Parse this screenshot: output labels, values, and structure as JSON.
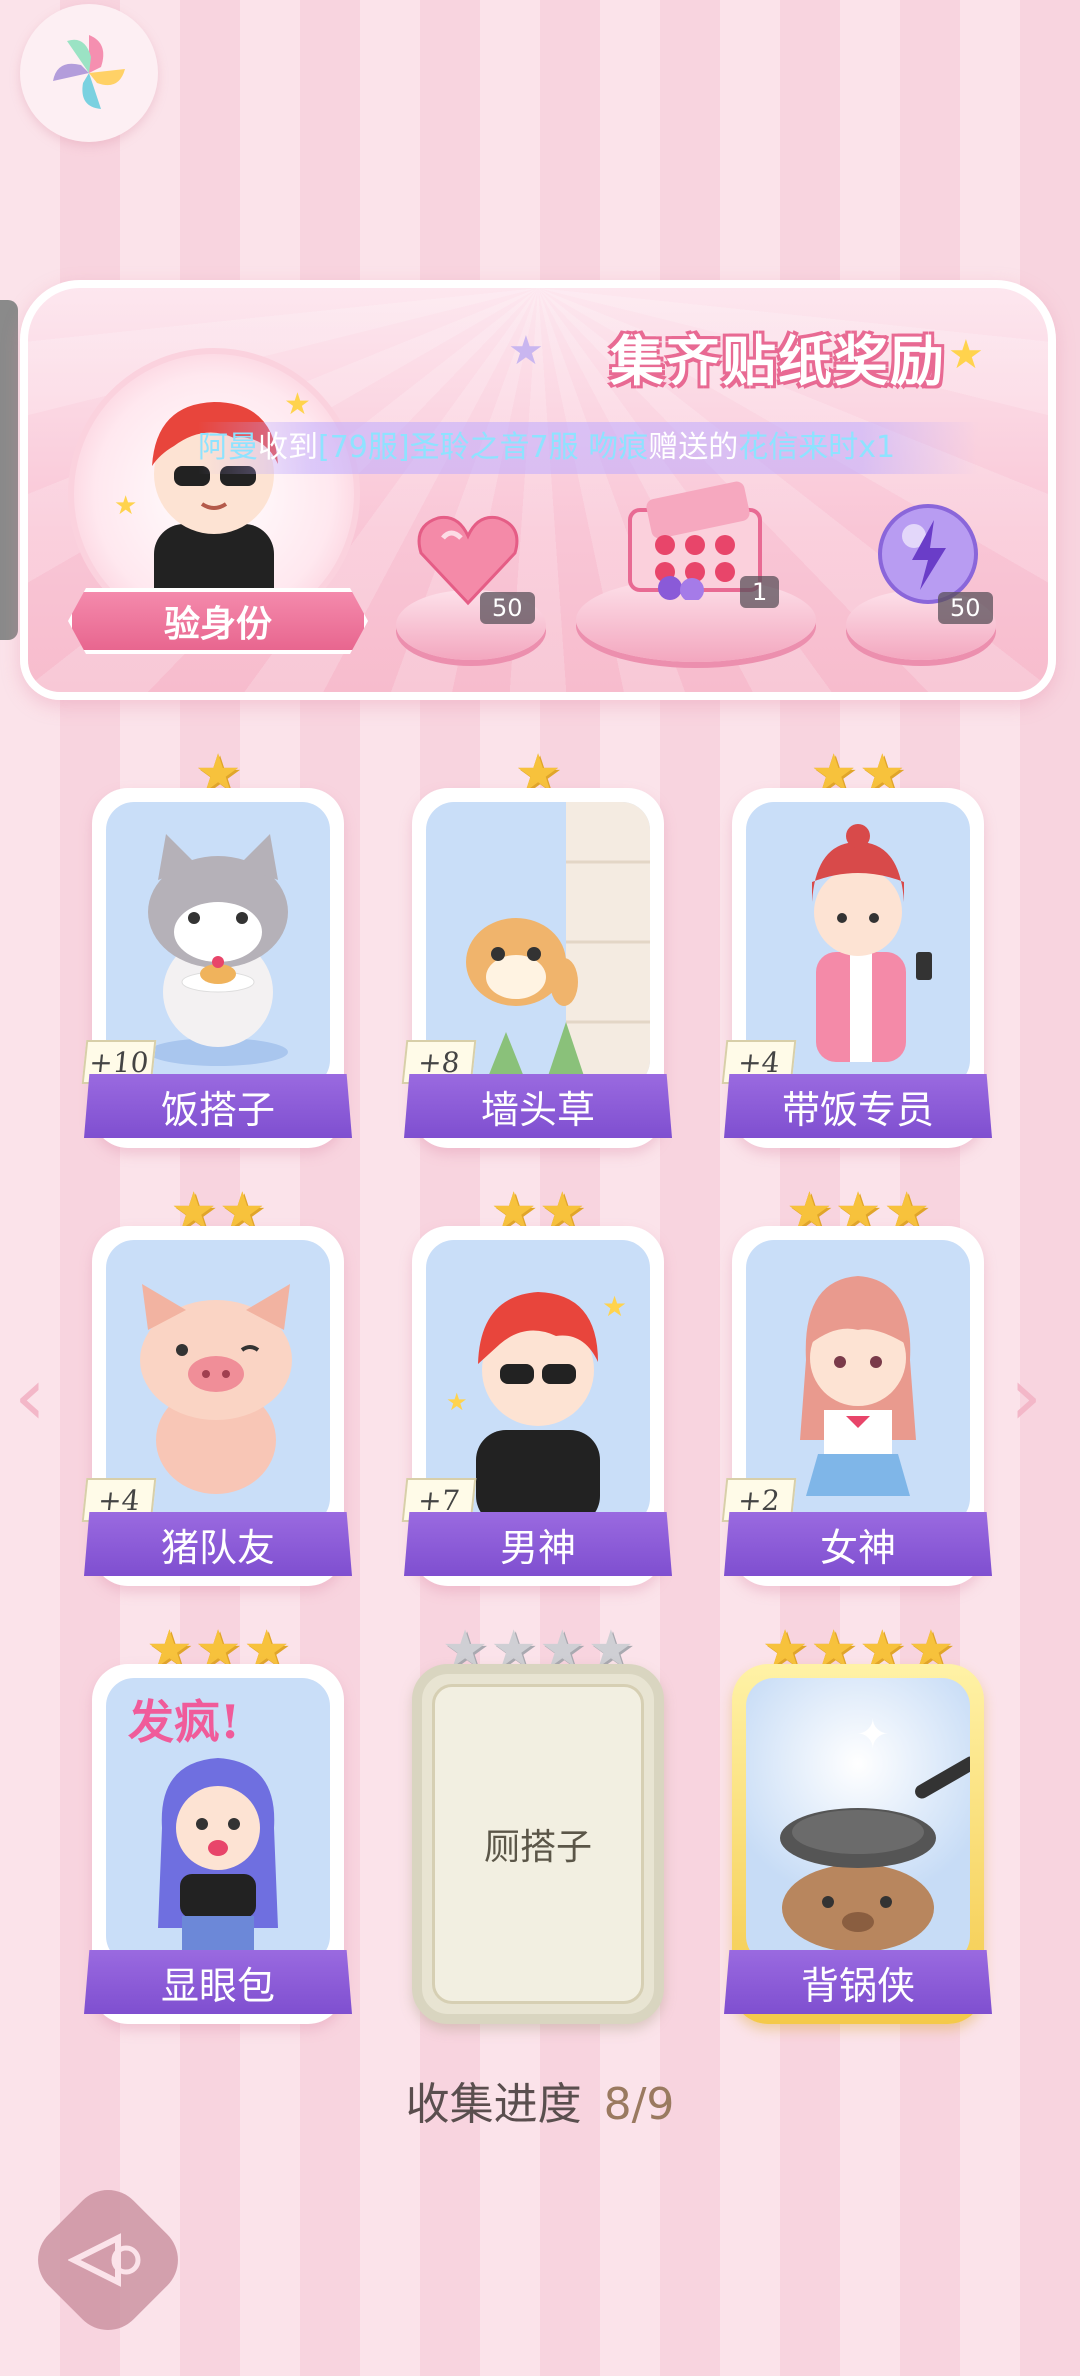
{
  "reward": {
    "title": "集齐贴纸奖励",
    "verify_label": "验身份",
    "marquee": {
      "user": "阿曼",
      "t1": "收到",
      "item": "[79服]圣聆之音7服",
      "t2": " ",
      "sender": "吻痕",
      "t3": "赠送的",
      "gift": "花信来时x1"
    },
    "items": [
      {
        "icon": "heart-gem-icon",
        "count": "50"
      },
      {
        "icon": "gift-box-icon",
        "count": "1"
      },
      {
        "icon": "lightning-orb-icon",
        "count": "50"
      }
    ]
  },
  "stickers": [
    {
      "name": "饭搭子",
      "bonus": "+10",
      "stars": 1,
      "state": "collected"
    },
    {
      "name": "墙头草",
      "bonus": "+8",
      "stars": 1,
      "state": "collected"
    },
    {
      "name": "带饭专员",
      "bonus": "+4",
      "stars": 2,
      "state": "collected"
    },
    {
      "name": "猪队友",
      "bonus": "+4",
      "stars": 2,
      "state": "collected"
    },
    {
      "name": "男神",
      "bonus": "+7",
      "stars": 2,
      "state": "collected"
    },
    {
      "name": "女神",
      "bonus": "+2",
      "stars": 3,
      "state": "collected"
    },
    {
      "name": "显眼包",
      "bonus": "",
      "stars": 3,
      "state": "collected",
      "sticker_text": "发疯!"
    },
    {
      "name": "厕搭子",
      "bonus": "",
      "stars": 4,
      "state": "locked"
    },
    {
      "name": "背锅侠",
      "bonus": "",
      "stars": 4,
      "state": "gold"
    }
  ],
  "progress": {
    "label": "收集进度",
    "value": "8/9"
  },
  "colors": {
    "label_purple": "#8a5ad8",
    "star_gold": "#f7c23c",
    "panel_pink": "#f9c6d6"
  }
}
